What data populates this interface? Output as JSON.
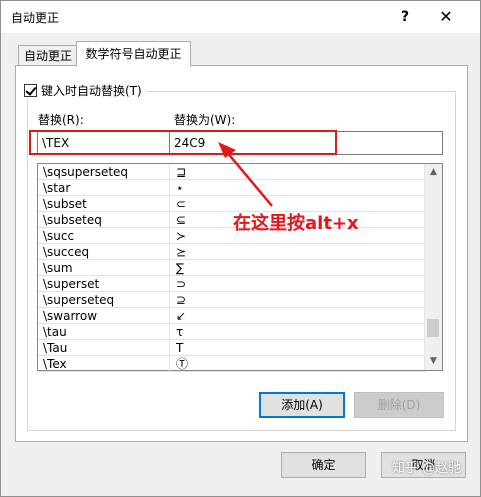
{
  "window": {
    "title": "自动更正",
    "help": "?",
    "close": "✕"
  },
  "tabs": [
    {
      "label": "自动更正",
      "active": false
    },
    {
      "label": "数学符号自动更正",
      "active": true
    }
  ],
  "options": {
    "replace_while_typing": "键入时自动替换(T)",
    "replace_while_typing_checked": true
  },
  "fields": {
    "replace_label": "替换(R):",
    "with_label": "替换为(W):",
    "replace_value": "\\TEX",
    "with_value": "24C9"
  },
  "entries": [
    {
      "key": "\\sqsuperseteq",
      "symbol": "⊒"
    },
    {
      "key": "\\star",
      "symbol": "⋆"
    },
    {
      "key": "\\subset",
      "symbol": "⊂"
    },
    {
      "key": "\\subseteq",
      "symbol": "⊆"
    },
    {
      "key": "\\succ",
      "symbol": "≻"
    },
    {
      "key": "\\succeq",
      "symbol": "⪰"
    },
    {
      "key": "\\sum",
      "symbol": "∑"
    },
    {
      "key": "\\superset",
      "symbol": "⊃"
    },
    {
      "key": "\\superseteq",
      "symbol": "⊇"
    },
    {
      "key": "\\swarrow",
      "symbol": "↙"
    },
    {
      "key": "\\tau",
      "symbol": "τ"
    },
    {
      "key": "\\Tau",
      "symbol": "Τ"
    },
    {
      "key": "\\Tex",
      "symbol": "Ⓣ"
    }
  ],
  "buttons": {
    "add": "添加(A)",
    "delete": "删除(D)",
    "ok": "确定",
    "cancel": "取消"
  },
  "annotation": {
    "text": "在这里按alt+x",
    "color": "#e5151c"
  },
  "watermark": "知乎 @赵驰"
}
